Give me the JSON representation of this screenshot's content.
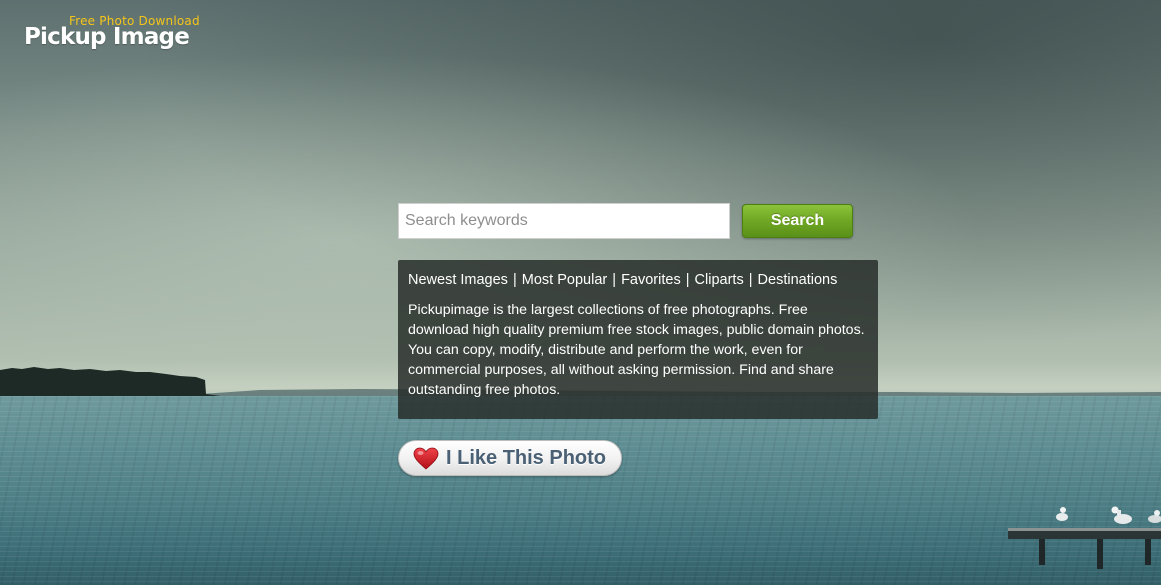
{
  "logo": {
    "tagline": "Free Photo Download",
    "name": "Pickup Image"
  },
  "search": {
    "placeholder": "Search keywords",
    "value": "",
    "button_label": "Search"
  },
  "nav": {
    "items": [
      {
        "label": "Newest Images"
      },
      {
        "label": "Most Popular"
      },
      {
        "label": "Favorites"
      },
      {
        "label": "Cliparts"
      },
      {
        "label": "Destinations"
      }
    ],
    "separator": "|"
  },
  "description": "Pickupimage is the largest collections of free photographs. Free download high quality premium free stock images, public domain photos. You can copy, modify, distribute and perform the work, even for commercial purposes, all without asking permission. Find and share outstanding free photos.",
  "like_button": {
    "label": "I Like This Photo",
    "icon": "heart-icon"
  },
  "colors": {
    "search_button": "#6fa724",
    "logo_tagline": "#f5c518",
    "like_text": "#4a6075",
    "heart": "#d7191f"
  }
}
